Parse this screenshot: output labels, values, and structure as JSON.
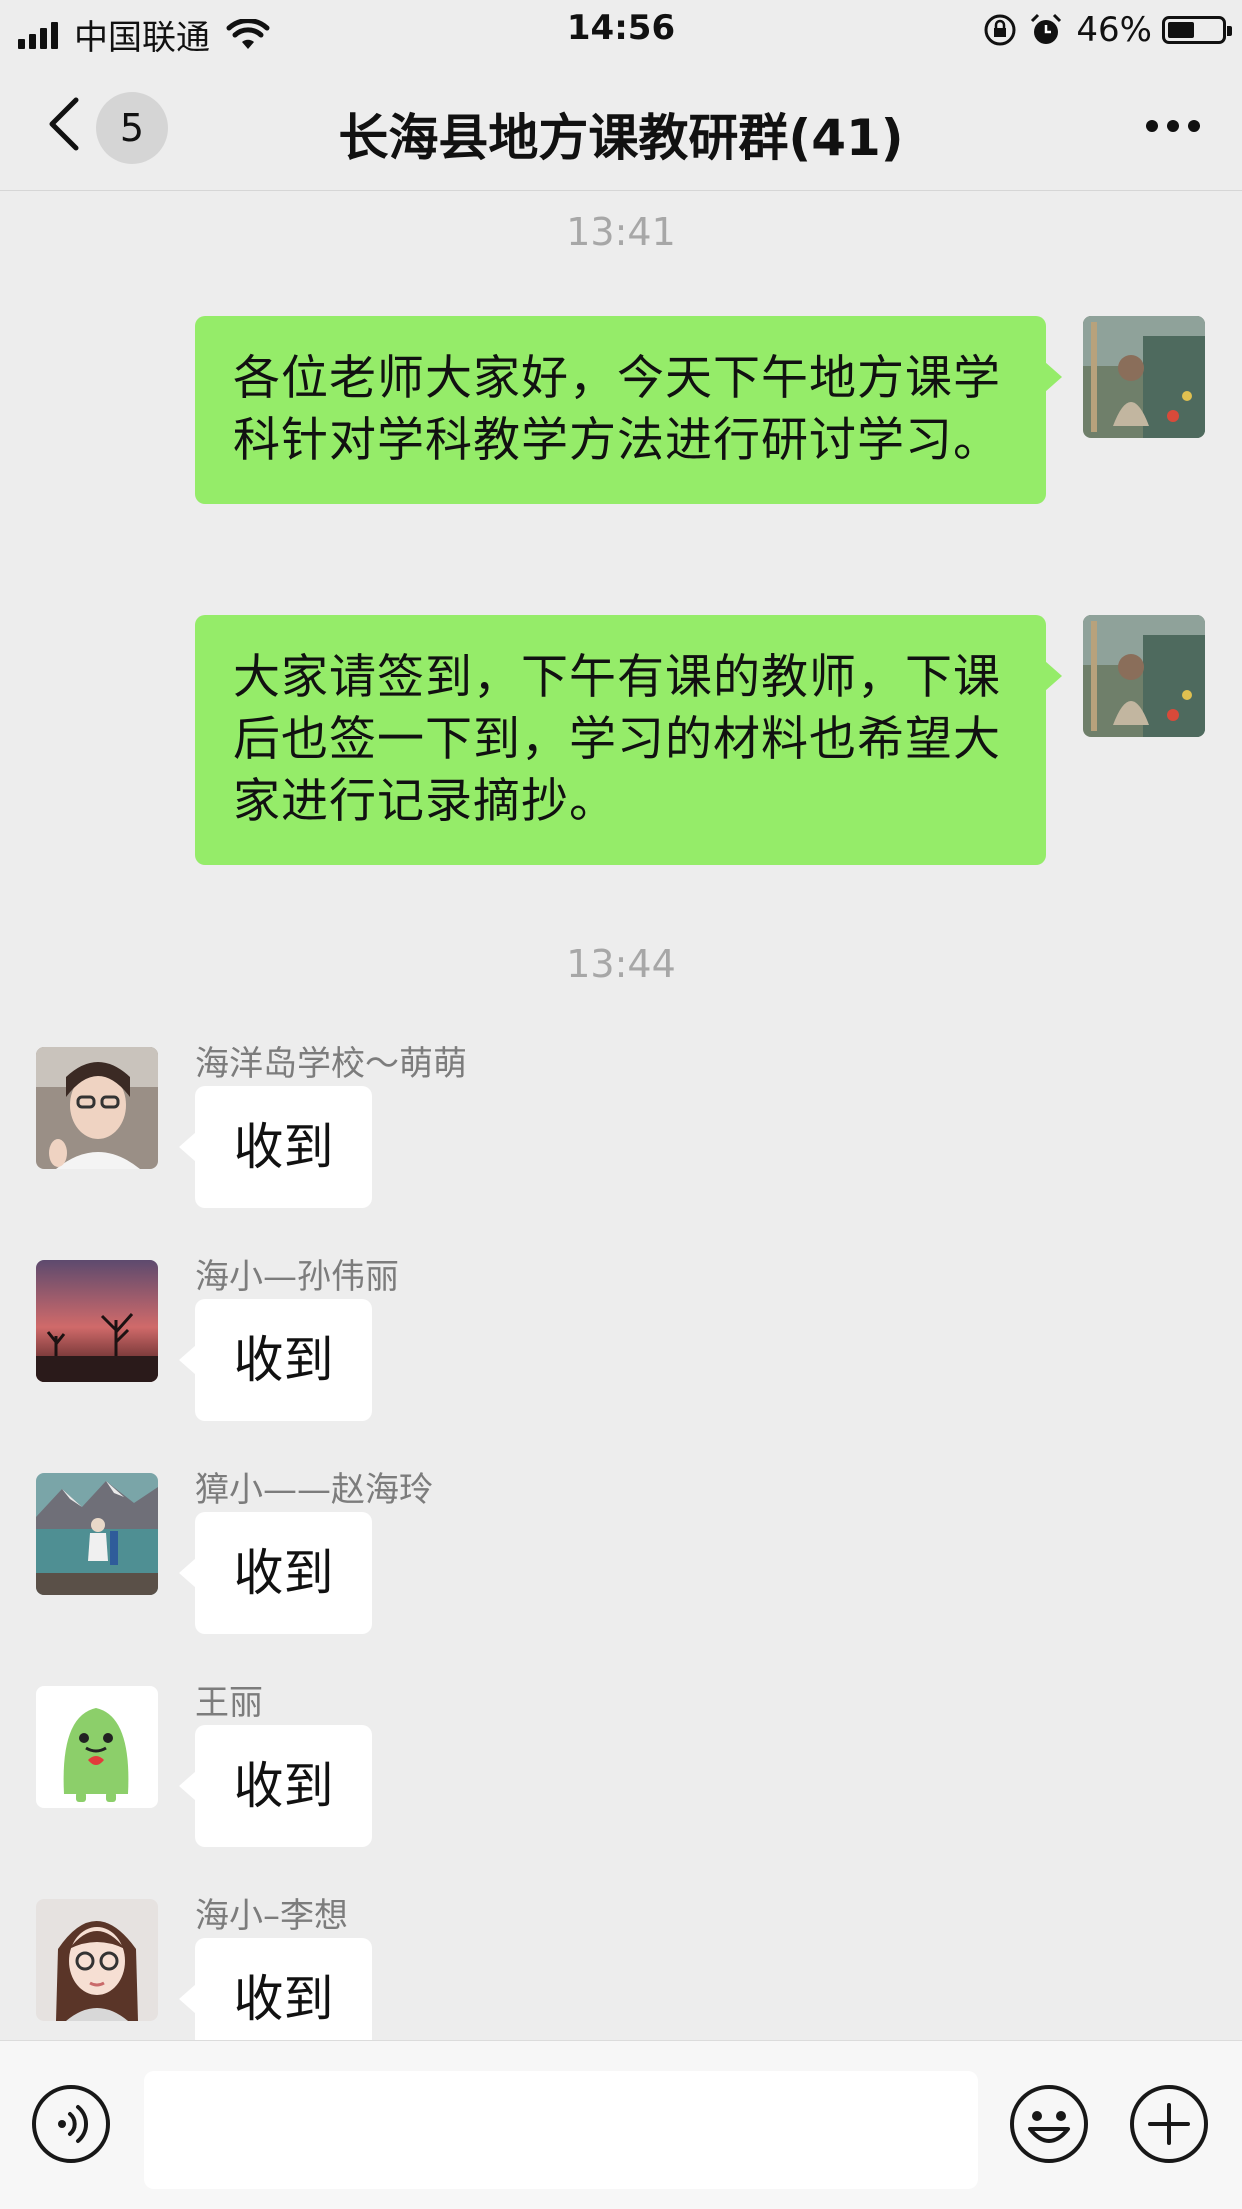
{
  "status_bar": {
    "carrier": "中国联通",
    "time": "14:56",
    "battery": "46%",
    "battery_level": 0.46,
    "icons": [
      "signal-icon",
      "wifi-icon",
      "orientation-lock-icon",
      "alarm-icon",
      "battery-icon"
    ]
  },
  "header": {
    "back_badge": "5",
    "title": "长海县地方课教研群(41)",
    "icons": [
      "back-icon",
      "more-icon"
    ]
  },
  "messages": {
    "time_1": "13:41",
    "out_1": "各位老师大家好，今天下午地方课学科针对学科教学方法进行研讨学习。",
    "out_2": "大家请签到，下午有课的教师，下课后也签一下到，学习的材料也希望大家进行记录摘抄。",
    "time_2": "13:44",
    "replies": [
      {
        "sender": "海洋岛学校～萌萌",
        "text": "收到"
      },
      {
        "sender": "海小—孙伟丽",
        "text": "收到"
      },
      {
        "sender": "獐小——赵海玲",
        "text": "收到"
      },
      {
        "sender": "王丽",
        "text": "收到"
      },
      {
        "sender": "海小–李想",
        "text": "收到"
      }
    ]
  },
  "input_bar": {
    "value": "",
    "icons": [
      "voice-icon",
      "emoji-icon",
      "plus-icon"
    ]
  },
  "colors": {
    "background": "#ededed",
    "outgoing_bubble": "#95ec69",
    "incoming_bubble": "#ffffff",
    "timestamp": "#a7a7a7",
    "sender_name": "#7c7c7c"
  }
}
